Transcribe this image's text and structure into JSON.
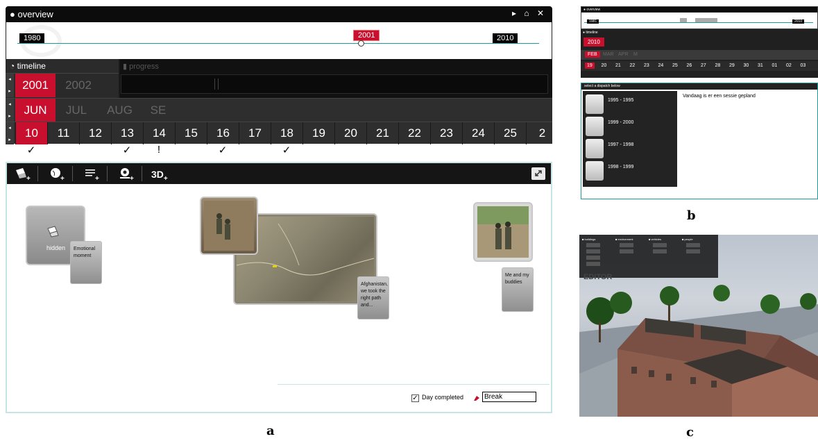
{
  "panel_a": {
    "overview": {
      "title": "overview",
      "controls": "▸ ⌂ ✕",
      "years": [
        "1980",
        "2001",
        "2010"
      ]
    },
    "timeline": {
      "tab_label": "timeline",
      "progress_label": "progress",
      "years": [
        "2001",
        "2002"
      ],
      "months": [
        "JUN",
        "JUL",
        "AUG",
        "SE"
      ],
      "days": [
        "10",
        "11",
        "12",
        "13",
        "14",
        "15",
        "16",
        "17",
        "18",
        "19",
        "20",
        "21",
        "22",
        "23",
        "24",
        "25",
        "2"
      ],
      "marks": [
        {
          "day": "10",
          "mark": "✓"
        },
        {
          "day": "13",
          "mark": "✓"
        },
        {
          "day": "14",
          "mark": "!"
        },
        {
          "day": "16",
          "mark": "✓"
        },
        {
          "day": "18",
          "mark": "✓"
        }
      ]
    },
    "editor": {
      "toolbar_3d": "3D",
      "hidden_card": {
        "label": "hidden",
        "note": "Emotional moment"
      },
      "map_card": {
        "note": "Afghanistan, we took the right path and..."
      },
      "photo_card": {
        "note": "Me and my buddies"
      },
      "footer": {
        "day_completed_label": "Day completed",
        "day_completed_checked": true,
        "break_value": "Break"
      }
    }
  },
  "panel_b": {
    "overview_title": "overview",
    "years": [
      "1981",
      "2010"
    ],
    "timeline_label": "timeline",
    "year": "2010",
    "months": [
      "FEB",
      "MAR",
      "APR",
      "M"
    ],
    "days": [
      "19",
      "20",
      "21",
      "22",
      "23",
      "24",
      "25",
      "26",
      "27",
      "28",
      "29",
      "30",
      "31",
      "01",
      "02",
      "03"
    ],
    "dispatch_header": "select a dispatch below",
    "dispatches": [
      {
        "range": "1995 - 1995"
      },
      {
        "range": "1999 - 2000"
      },
      {
        "range": "1997 - 1998"
      },
      {
        "range": "1998 - 1999"
      }
    ],
    "message": "Vandaag is er een sessie gepland"
  },
  "panel_c": {
    "menu_headers": [
      "buildings",
      "environment",
      "vehicles",
      "people"
    ],
    "editor_label": "EDITOR"
  },
  "captions": {
    "a": "a",
    "b": "b",
    "c": "c"
  },
  "colors": {
    "accent": "#c8102e",
    "teal": "#1f9a9a",
    "bar": "#0c0c0c"
  }
}
